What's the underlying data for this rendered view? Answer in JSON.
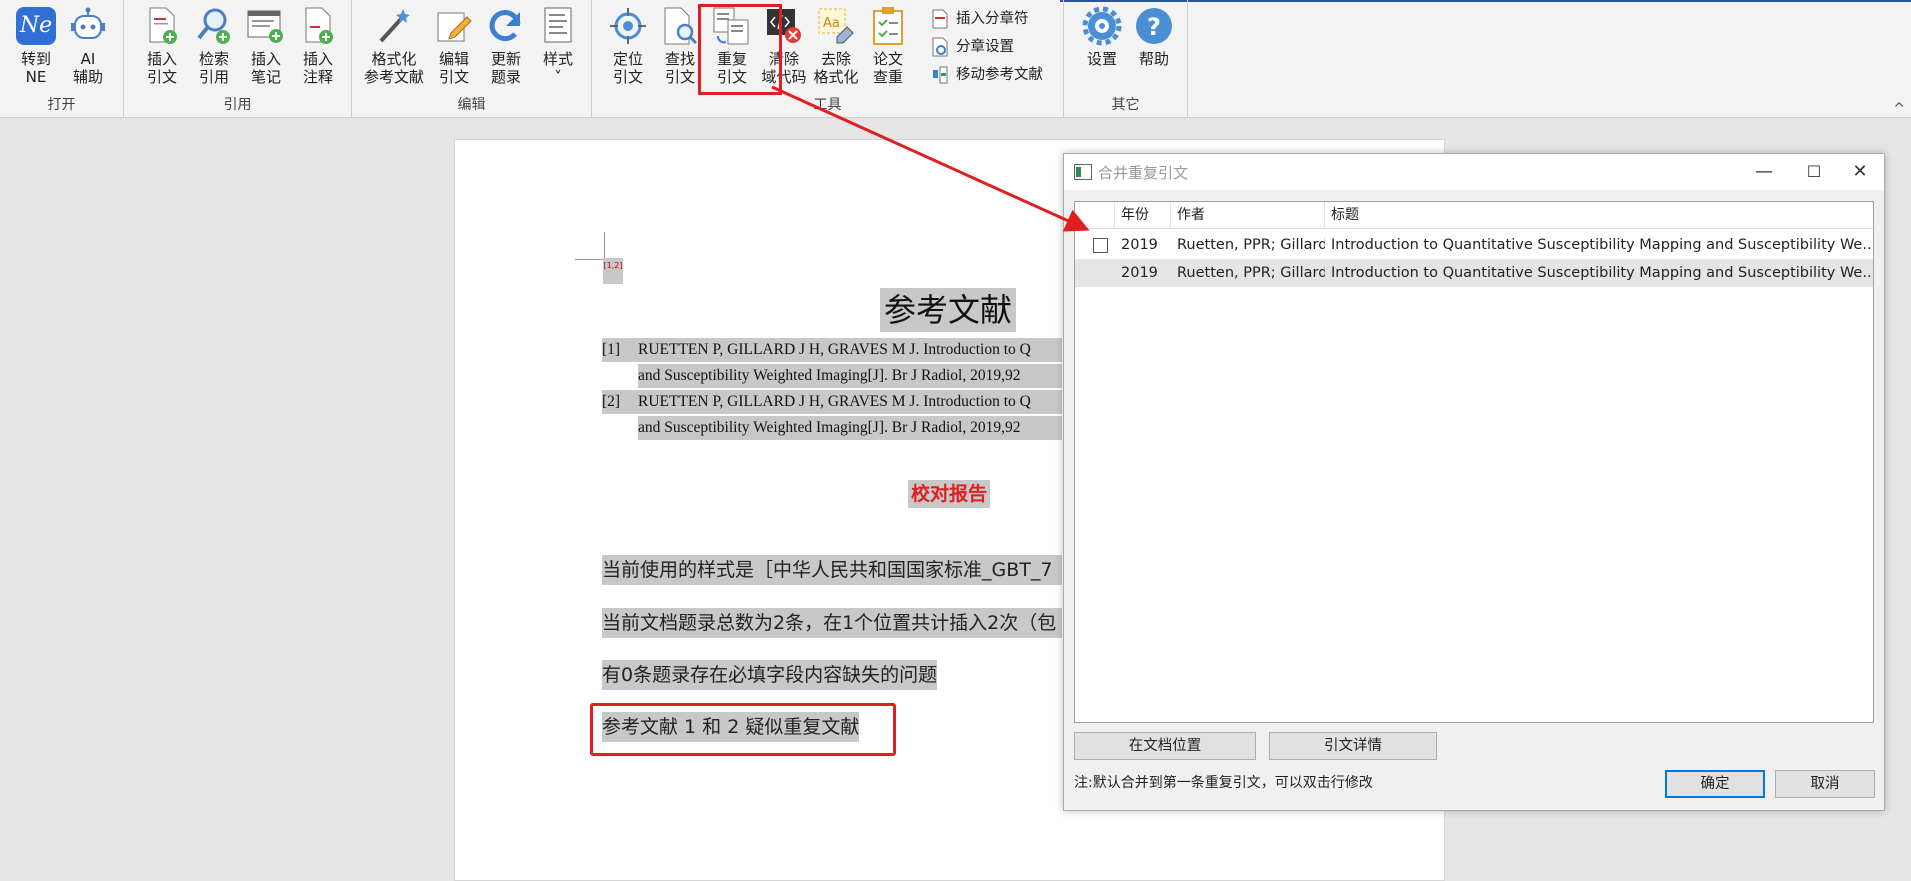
{
  "ribbon": {
    "groups": {
      "open": "打开",
      "cite": "引用",
      "edit": "编辑",
      "tools": "工具",
      "other": "其它"
    },
    "buttons": {
      "to_ne": "转到\nNE",
      "ai": "AI\n辅助",
      "insert_cite": "插入\n引文",
      "search_cite": "检索\n引用",
      "insert_note": "插入\n笔记",
      "insert_annot": "插入\n注释",
      "format_refs": "格式化\n参考文献",
      "edit_cite": "编辑\n引文",
      "update_refs": "更新\n题录",
      "style": "样式\n˅",
      "locate_cite": "定位\n引文",
      "find_cite": "查找\n引文",
      "dup_cite": "重复\n引文",
      "clear_field": "清除\n域代码",
      "unformat": "去除\n格式化",
      "plagiarism": "论文\n查重",
      "settings": "设置",
      "help": "帮助"
    },
    "small_buttons": {
      "insert_section": "插入分章符",
      "section_settings": "分章设置",
      "move_refs": "移动参考文献"
    },
    "ne_logo": "Ne",
    "collapse": "^"
  },
  "document": {
    "field_mark": "[1,2]",
    "ref_title": "参考文献",
    "refs": [
      {
        "num": "[1]",
        "line1": "RUETTEN P, GILLARD J H, GRAVES M J. Introduction to Q",
        "line2": "and Susceptibility Weighted    Imaging[J]. Br J Radiol, 2019,92"
      },
      {
        "num": "[2]",
        "line1": "RUETTEN P, GILLARD J H, GRAVES M J. Introduction to Q",
        "line2": "and Susceptibility Weighted    Imaging[J]. Br J Radiol, 2019,92"
      }
    ],
    "report_title": "校对报告",
    "para1": "当前使用的样式是［中华人民共和国国家标准_GBT_7",
    "para2": "当前文档题录总数为2条，在1个位置共计插入2次（包",
    "para3": "有0条题录存在必填字段内容缺失的问题",
    "para4": "参考文献  1  和  2  疑似重复文献"
  },
  "dialog": {
    "title": "合并重复引文",
    "columns": {
      "year": "年份",
      "author": "作者",
      "title": "标题"
    },
    "rows": [
      {
        "checked": false,
        "year": "2019",
        "author": "Ruetten, PPR; Gillard, J H;...",
        "title": "Introduction to Quantitative Susceptibility Mapping and Susceptibility We..."
      },
      {
        "year": "2019",
        "author": "Ruetten, PPR; Gillard, J H;...",
        "title": "Introduction to Quantitative Susceptibility Mapping and Susceptibility We..."
      }
    ],
    "btn_doc_pos": "在文档位置",
    "btn_cite_detail": "引文详情",
    "note": "注:默认合并到第一条重复引文，可以双击行修改",
    "btn_ok": "确定",
    "btn_cancel": "取消",
    "win_min": "—",
    "win_max": "☐",
    "win_close": "✕"
  },
  "colors": {
    "highlight_red": "#e02020",
    "ribbon_bg": "#f3f3f3",
    "selected_row": "#e5e5e5",
    "ne_blue": "#2f6fd6"
  }
}
